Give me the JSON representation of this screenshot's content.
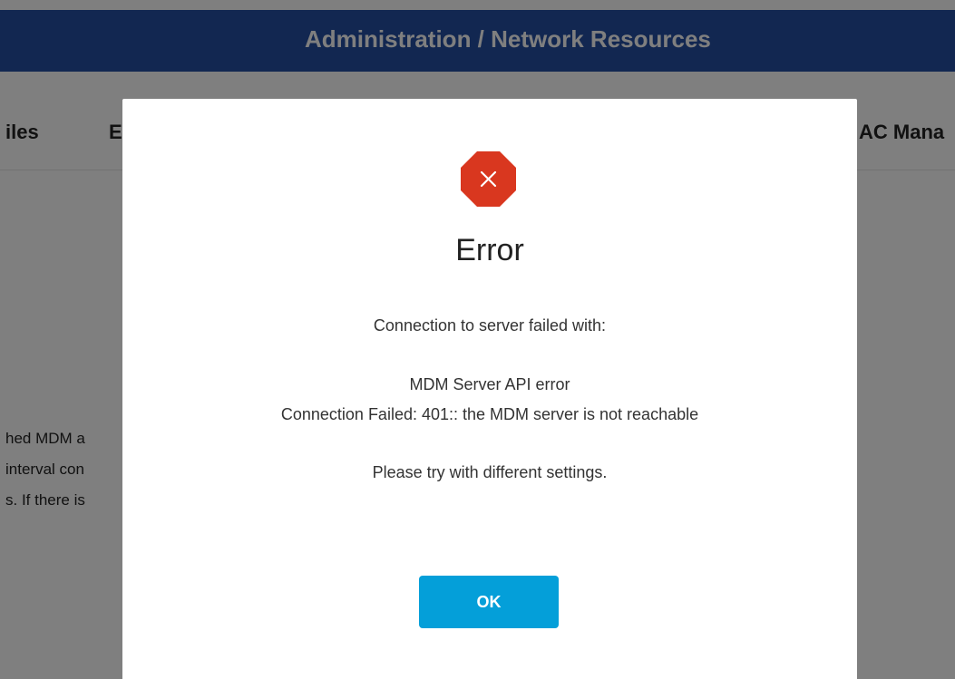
{
  "header": {
    "title": "Administration / Network Resources"
  },
  "tabs": [
    {
      "label": "iles"
    },
    {
      "label": "E"
    },
    {
      "label": "AC Mana"
    }
  ],
  "background_text": [
    "hed MDM a",
    "interval con",
    "s. If there is"
  ],
  "dialog": {
    "icon": "error-x-icon",
    "title": "Error",
    "message_intro": "Connection to server failed with:",
    "error_name": "MDM Server API error",
    "error_detail": "Connection Failed: 401:: the MDM server is not reachable",
    "hint": "Please try with different settings.",
    "ok_label": "OK"
  },
  "colors": {
    "header_bg": "#254ea2",
    "error_icon": "#d9371f",
    "ok_button": "#049fd9"
  }
}
